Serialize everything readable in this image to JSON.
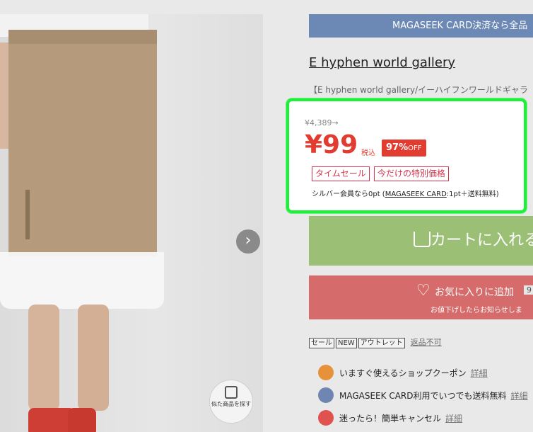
{
  "banner": {
    "text": "MAGASEEK CARD決済なら全品"
  },
  "brand": {
    "name": "E hyphen world gallery",
    "subtitle": "【E hyphen world gallery/イーハイフンワールドギャラ"
  },
  "price": {
    "original": "¥4,389→",
    "sale": "¥99",
    "tax_label": "税込",
    "discount": "97%",
    "discount_suffix": "OFF",
    "tag_timesale": "タイムセール",
    "tag_special": "今だけの特別価格",
    "points_prefix": "シルバー会員なら0pt (",
    "points_card": "MAGASEEK CARD",
    "points_suffix": ":1pt＋送料無料)"
  },
  "buttons": {
    "cart": "カートに入れる",
    "favorite": "お気に入りに追加",
    "favorite_count": "9",
    "favorite_sub": "お値下げしたらお知らせしま"
  },
  "chips": [
    "セール",
    "NEW",
    "アウトレット"
  ],
  "no_return": "返品不可",
  "features": [
    {
      "text": "いますぐ使えるショップクーポン",
      "more": "詳細",
      "color": "#e7913a"
    },
    {
      "text": "MAGASEEK CARD利用でいつでも送料無料",
      "more": "詳細",
      "color": "#6f86b3"
    },
    {
      "text": "迷ったら！簡単キャンセル",
      "more": "詳細",
      "color": "#e05250"
    }
  ],
  "similar": {
    "label": "似た商品を探す"
  }
}
